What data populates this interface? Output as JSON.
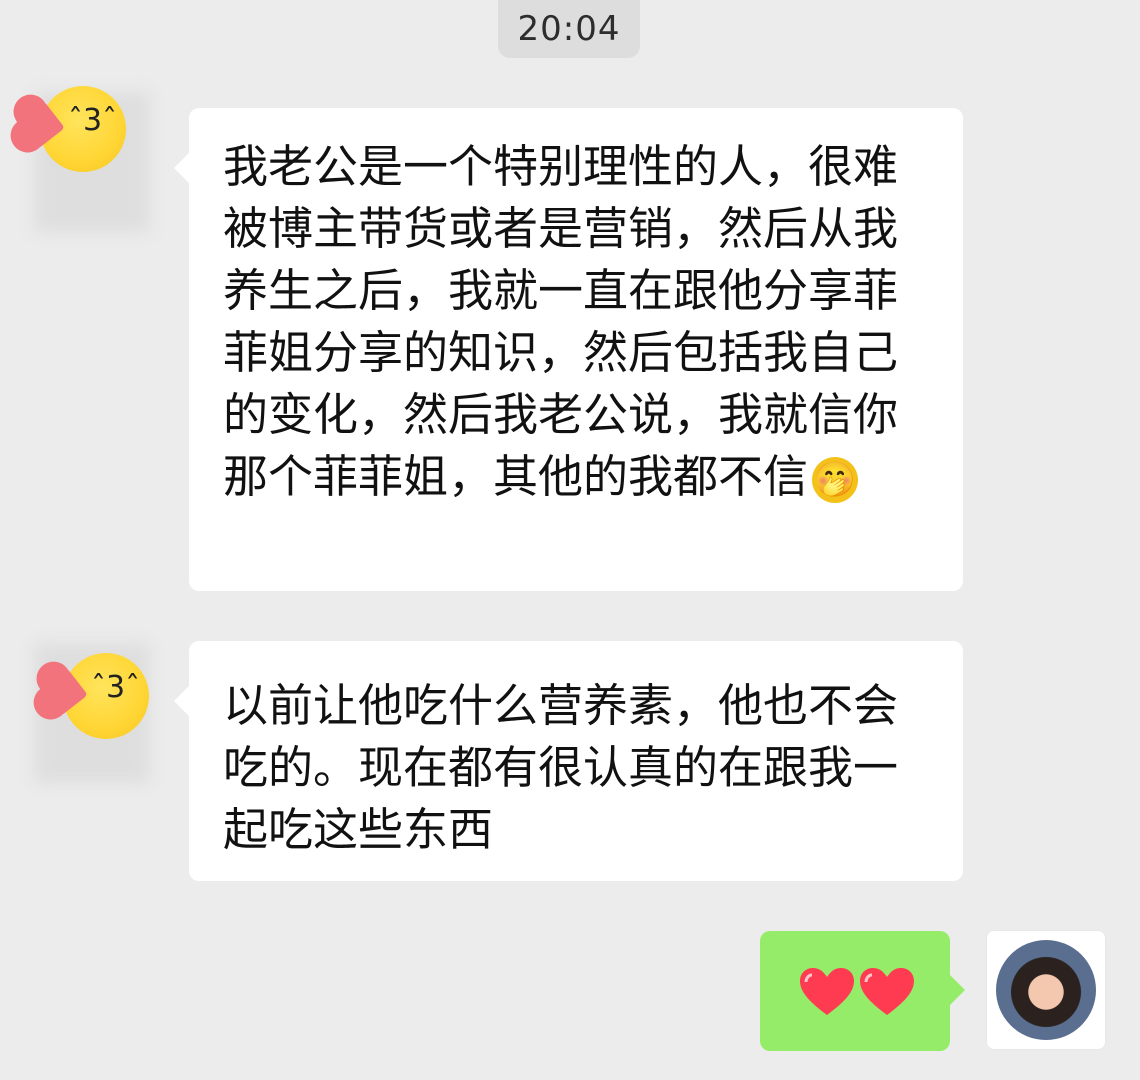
{
  "time": "20:04",
  "messages": [
    {
      "text": "我老公是一个特别理性的人，很难被博主带货或者是营销，然后从我养生之后，我就一直在跟他分享菲菲姐分享的知识，然后包括我自己的变化，然后我老公说，我就信你那个菲菲姐，其他的我都不信",
      "inline_emoji": "🤭",
      "sender_avatar": "blush-kiss-emoji-avatar"
    },
    {
      "text": "以前让他吃什么营养素，他也不会吃的。现在都有很认真的在跟我一起吃这些东西",
      "sender_avatar": "blush-kiss-emoji-avatar"
    },
    {
      "text": "❤❤",
      "sender_avatar": "self-photo-avatar"
    }
  ],
  "colors": {
    "background": "#ececec",
    "time_chip": "#dddddd",
    "incoming_bubble": "#ffffff",
    "outgoing_bubble": "#95ec69",
    "heart": "#ff3b52"
  }
}
